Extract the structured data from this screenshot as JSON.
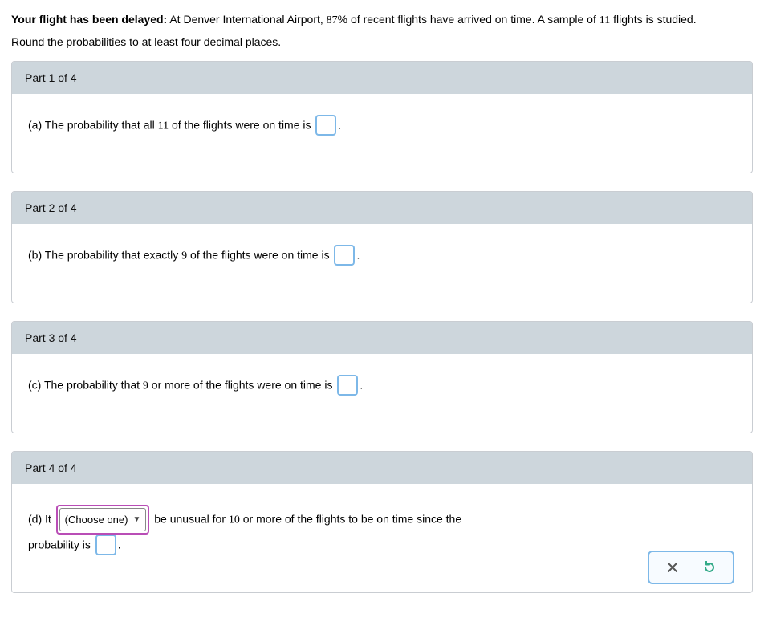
{
  "intro": {
    "bold": "Your flight has been delayed:",
    "text_a": " At Denver International Airport, ",
    "percent": "87",
    "text_b": "% of recent flights have arrived on time. A sample of ",
    "n": "11",
    "text_c": " flights is studied."
  },
  "instructions": "Round the probabilities to at least four decimal places.",
  "parts": {
    "p1": {
      "header": "Part 1 of 4",
      "label": "(a) The probability that all ",
      "n": "11",
      "tail": " of the flights were on time is "
    },
    "p2": {
      "header": "Part 2 of 4",
      "label": "(b) The probability that exactly ",
      "n": "9",
      "tail": " of the flights were on time is "
    },
    "p3": {
      "header": "Part 3 of 4",
      "label": "(c) The probability that ",
      "n": "9",
      "tail": " or more of the flights were on time is "
    },
    "p4": {
      "header": "Part 4 of 4",
      "lead": "(d) It ",
      "dropdown": "(Choose one)",
      "mid": " be unusual for ",
      "n": "10",
      "mid2": " or more of the flights to be on time since the",
      "line2": "probability is "
    }
  },
  "period": "."
}
